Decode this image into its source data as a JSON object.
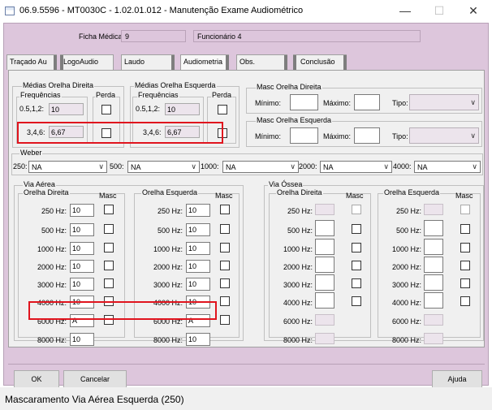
{
  "window": {
    "title": "06.9.5596 - MT0030C - 1.02.01.012 - Manutenção Exame Audiométrico",
    "minimize_icon": "minimize-icon",
    "maximize_icon": "maximize-icon",
    "close_icon": "close-icon"
  },
  "header": {
    "ficha_label": "Ficha Médica:",
    "ficha_value": "9",
    "funcionario_value": "Funcionário 4"
  },
  "tabs": [
    "Traçado Au",
    "LogoAudio",
    "Laudo",
    "Audiometria",
    "Obs.",
    "Conclusão"
  ],
  "active_tab": "Audiometria",
  "medias_direita": {
    "title": "Médias Orelha Direita",
    "freq_label": "Frequências",
    "perda_label": "Perda",
    "row1_label": "0.5,1,2:",
    "row1_value": "10",
    "row2_label": "3,4,6:",
    "row2_value": "6,67"
  },
  "medias_esquerda": {
    "title": "Médias Orelha Esquerda",
    "freq_label": "Frequências",
    "perda_label": "Perda",
    "row1_label": "0.5,1,2:",
    "row1_value": "10",
    "row2_label": "3,4,6:",
    "row2_value": "6,67"
  },
  "masc_direita": {
    "title": "Masc Orelha Direita",
    "min_label": "Mínimo:",
    "max_label": "Máximo:",
    "tipo_label": "Tipo:"
  },
  "masc_esquerda": {
    "title": "Masc Orelha Esquerda",
    "min_label": "Mínimo:",
    "max_label": "Máximo:",
    "tipo_label": "Tipo:"
  },
  "weber": {
    "title": "Weber",
    "items": [
      {
        "label": "250:",
        "value": "NA"
      },
      {
        "label": "500:",
        "value": "NA"
      },
      {
        "label": "1000:",
        "value": "NA"
      },
      {
        "label": "2000:",
        "value": "NA"
      },
      {
        "label": "4000:",
        "value": "NA"
      }
    ]
  },
  "via_aerea": {
    "title": "Via Aérea",
    "direita_title": "Orelha Direita",
    "esquerda_title": "Orelha Esquerda",
    "masc_label": "Masc",
    "freqs": [
      "250 Hz:",
      "500 Hz:",
      "1000 Hz:",
      "2000 Hz:",
      "3000 Hz:",
      "4000 Hz:",
      "6000 Hz:",
      "8000 Hz:"
    ],
    "direita_values": [
      "10",
      "10",
      "10",
      "10",
      "10",
      "10",
      "A",
      "10"
    ],
    "esquerda_values": [
      "10",
      "10",
      "10",
      "10",
      "10",
      "10",
      "A",
      "10"
    ]
  },
  "via_ossea": {
    "title": "Via Óssea",
    "direita_title": "Orelha Direita",
    "esquerda_title": "Orelha Esquerda",
    "masc_label": "Masc",
    "freqs": [
      "250 Hz:",
      "500 Hz:",
      "1000 Hz:",
      "2000 Hz:",
      "3000 Hz:",
      "4000 Hz:",
      "6000 Hz:",
      "8000 Hz:"
    ]
  },
  "buttons": {
    "ok": "OK",
    "cancel": "Cancelar",
    "help": "Ajuda"
  },
  "status": "Mascaramento Via Aérea Esquerda (250)",
  "colors": {
    "frame": "#ddc6dc",
    "highlight_border": "#e0141e"
  }
}
